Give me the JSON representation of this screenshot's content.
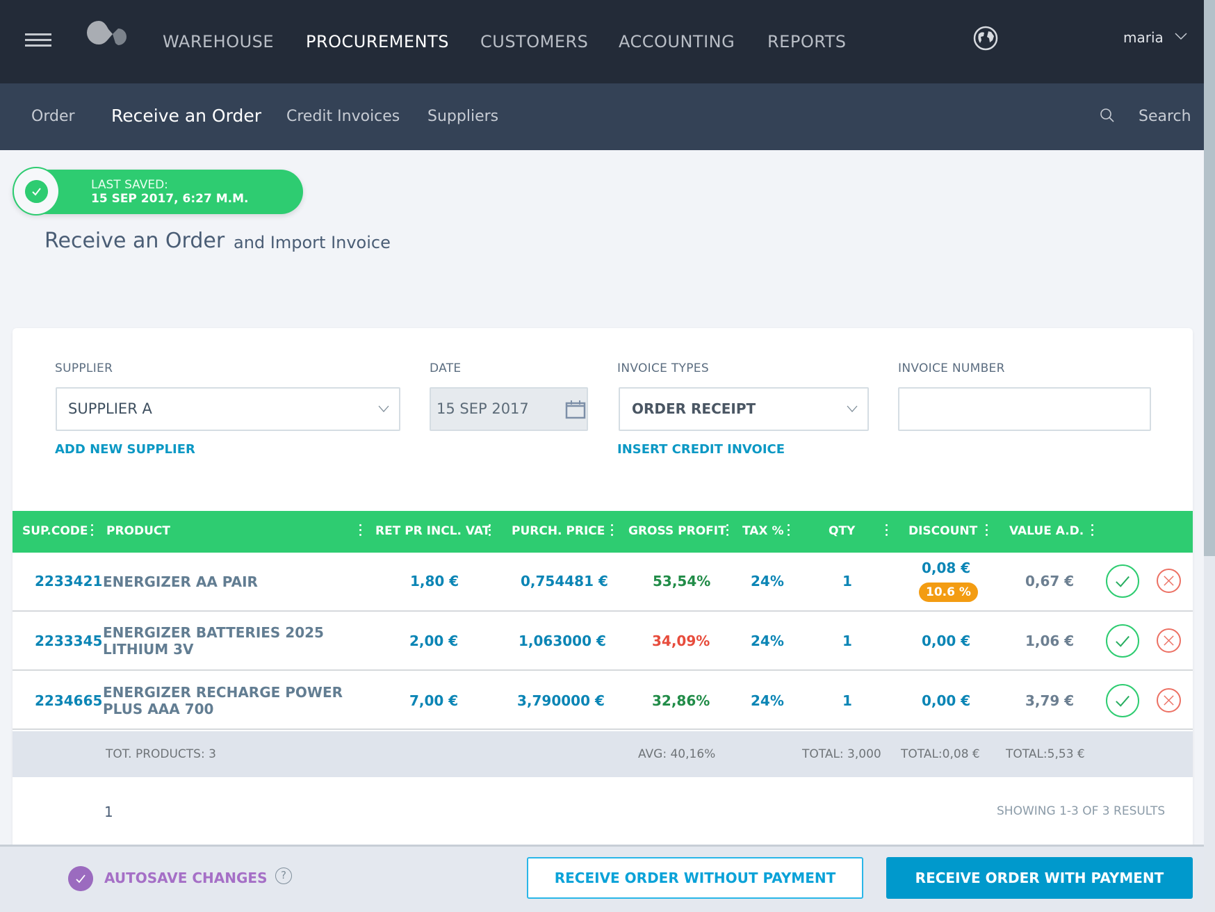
{
  "topnav": {
    "items": [
      {
        "label": "WAREHOUSE",
        "active": false
      },
      {
        "label": "PROCUREMENTS",
        "active": true
      },
      {
        "label": "CUSTOMERS",
        "active": false
      },
      {
        "label": "ACCOUNTING",
        "active": false
      },
      {
        "label": "REPORTS",
        "active": false
      }
    ],
    "user": "maria",
    "icons": {
      "menu": "hamburger-icon",
      "logo": "app-logo",
      "language": "globe-icon",
      "user_menu": "chevron-down-icon"
    }
  },
  "subnav": {
    "items": [
      {
        "label": "Order",
        "active": false
      },
      {
        "label": "Receive an Order",
        "active": true
      },
      {
        "label": "Credit Invoices",
        "active": false
      },
      {
        "label": "Suppliers",
        "active": false
      }
    ],
    "search_label": "Search"
  },
  "saved": {
    "label": "LAST SAVED:",
    "value": "15 SEP 2017, 6:27 M.M."
  },
  "page": {
    "title": "Receive an Order",
    "subtitle": "and Import Invoice"
  },
  "form": {
    "supplier": {
      "label": "SUPPLIER",
      "value": "SUPPLIER A",
      "link": "ADD NEW SUPPLIER"
    },
    "date": {
      "label": "DATE",
      "value": "15 SEP 2017"
    },
    "invoice_type": {
      "label": "INVOICE TYPES",
      "value": "ORDER RECEIPT",
      "link": "INSERT CREDIT INVOICE"
    },
    "invoice_number": {
      "label": "INVOICE NUMBER",
      "value": ""
    }
  },
  "table": {
    "columns": [
      "SUP.CODE",
      "PRODUCT",
      "RET PR INCL. VAT",
      "PURCH. PRICE",
      "GROSS PROFIT",
      "TAX %",
      "QTY",
      "DISCOUNT",
      "VALUE A.D."
    ],
    "rows": [
      {
        "code": "2233421",
        "product_1": "ENERGIZER AA PAIR",
        "product_2": "",
        "retail": "1,80 €",
        "purchase": "0,754481 €",
        "profit": "53,54%",
        "profit_status": "good",
        "tax": "24%",
        "qty": "1",
        "discount": "0,08 €",
        "discount_pct": "10.6 %",
        "value": "0,67 €"
      },
      {
        "code": "2233345",
        "product_1": "ENERGIZER BATTERIES 2025",
        "product_2": "LITHIUM 3V",
        "retail": "2,00 €",
        "purchase": "1,063000 €",
        "profit": "34,09%",
        "profit_status": "bad",
        "tax": "24%",
        "qty": "1",
        "discount": "0,00 €",
        "discount_pct": "",
        "value": "1,06 €"
      },
      {
        "code": "2234665",
        "product_1": "ENERGIZER RECHARGE POWER",
        "product_2": "PLUS AAA 700",
        "retail": "7,00 €",
        "purchase": "3,790000 €",
        "profit": "32,86%",
        "profit_status": "good",
        "tax": "24%",
        "qty": "1",
        "discount": "0,00 €",
        "discount_pct": "",
        "value": "3,79 €"
      }
    ],
    "totals": {
      "products": "TOT. PRODUCTS: 3",
      "avg_profit": "AVG: 40,16%",
      "qty": "TOTAL: 3,000",
      "discount": "TOTAL:0,08 €",
      "value": "TOTAL:5,53 €"
    },
    "pagination": {
      "current_page": "1",
      "showing": "SHOWING 1-3 OF 3 RESULTS"
    }
  },
  "footer": {
    "autosave_label": "AUTOSAVE CHANGES",
    "autosave_checked": true,
    "help": "?",
    "btn_without_payment": "RECEIVE ORDER WITHOUT PAYMENT",
    "btn_with_payment": "RECEIVE ORDER WITH PAYMENT"
  },
  "colors": {
    "topnav": "#232b38",
    "subnav": "#344256",
    "accent_green": "#2ecc71",
    "link_blue": "#0b98c4",
    "primary_button": "#0099cc",
    "profit_good": "#218c48",
    "profit_bad": "#e74c3c",
    "discount_badge": "#f39c12",
    "autosave_purple": "#9b6bbf"
  }
}
